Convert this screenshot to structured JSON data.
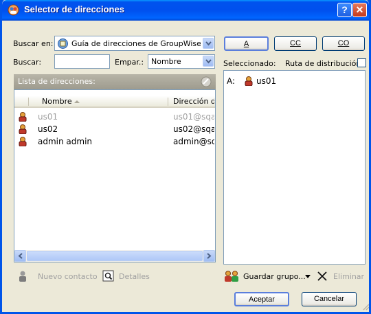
{
  "window": {
    "title": "Selector de direcciones",
    "help_glyph": "?",
    "close_glyph": "✕"
  },
  "search_in": {
    "label": "Buscar en:",
    "value": "Guía de direcciones de GroupWise c"
  },
  "search": {
    "label": "Buscar:",
    "value": ""
  },
  "match": {
    "label": "Empar.:",
    "value": "Nombre"
  },
  "address_list": {
    "header": "Lista de direcciones:",
    "columns": [
      "Nombre",
      "Dirección d"
    ],
    "rows": [
      {
        "name": "us01",
        "email": "us01@sqa",
        "dimmed": true
      },
      {
        "name": "us02",
        "email": "us02@sqa",
        "dimmed": false
      },
      {
        "name": "admin admin",
        "email": "admin@sq",
        "dimmed": false
      }
    ]
  },
  "buttons": {
    "to": "A",
    "cc": "CC",
    "bc": "CO",
    "accept": "Aceptar",
    "cancel": "Cancelar"
  },
  "selected": {
    "label": "Seleccionado:",
    "distribution_label": "Ruta de distribución",
    "distribution_checked": false,
    "entries": [
      {
        "prefix": "A:",
        "name": "us01"
      }
    ]
  },
  "bottom_left": {
    "new_contact": "Nuevo contacto",
    "details": "Detalles"
  },
  "bottom_right": {
    "save_group": "Guardar grupo...",
    "delete": "Eliminar"
  },
  "colors": {
    "title_blue": "#0054e3",
    "dialog_bg": "#ece9d8",
    "list_border": "#7f9db9"
  }
}
